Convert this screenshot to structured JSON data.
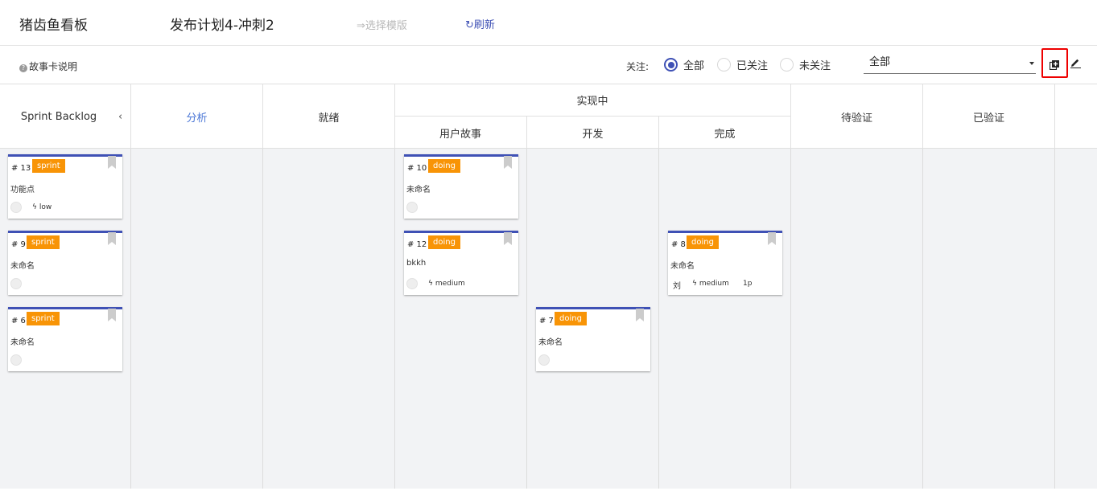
{
  "topbar": {
    "app_title": "猪齿鱼看板",
    "plan_title": "发布计划4-冲刺2",
    "template_label": "选择模版",
    "refresh_label": "刷新"
  },
  "filterbar": {
    "help_label": "故事卡说明",
    "follow_label": "关注:",
    "radios": [
      {
        "label": "全部",
        "checked": true
      },
      {
        "label": "已关注",
        "checked": false
      },
      {
        "label": "未关注",
        "checked": false
      }
    ],
    "select_value": "全部"
  },
  "columns": {
    "backlog": "Sprint Backlog",
    "analysis": "分析",
    "ready": "就绪",
    "implementing": "实现中",
    "user_story": "用户故事",
    "develop": "开发",
    "done": "完成",
    "to_verify": "待验证",
    "verified": "已验证"
  },
  "cards": {
    "c13": {
      "num": "# 13",
      "tag": "sprint",
      "title": "功能点",
      "priority": "low"
    },
    "c9": {
      "num": "# 9",
      "tag": "sprint",
      "title": "未命名"
    },
    "c6": {
      "num": "# 6",
      "tag": "sprint",
      "title": "未命名"
    },
    "c10": {
      "num": "# 10",
      "tag": "doing",
      "title": "未命名"
    },
    "c12": {
      "num": "# 12",
      "tag": "doing",
      "title": "bkkh",
      "priority": "medium"
    },
    "c7": {
      "num": "# 7",
      "tag": "doing",
      "title": "未命名"
    },
    "c8": {
      "num": "# 8",
      "tag": "doing",
      "title": "未命名",
      "assignee": "刘",
      "priority": "medium",
      "points": "1p"
    }
  },
  "colors": {
    "accent": "#3f51b5",
    "tag": "#f89406",
    "link": "#4a76d6",
    "highlight_border": "#ee0000"
  },
  "icons": [
    "template-icon",
    "refresh-icon",
    "help-icon",
    "add-card-icon",
    "edit-icon",
    "chevron-left-icon",
    "bookmark-icon",
    "bolt-icon"
  ]
}
